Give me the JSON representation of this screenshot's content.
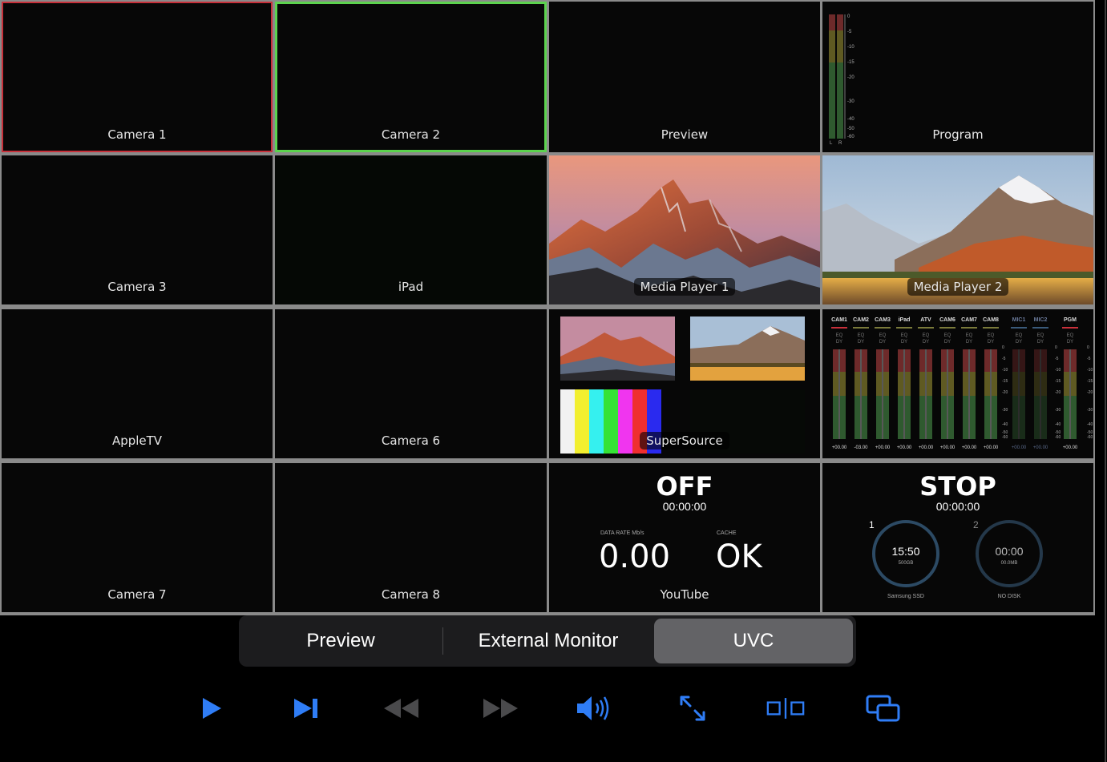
{
  "tiles": [
    {
      "id": "camera-1",
      "label": "Camera 1"
    },
    {
      "id": "camera-2",
      "label": "Camera 2"
    },
    {
      "id": "preview",
      "label": "Preview"
    },
    {
      "id": "program",
      "label": "Program"
    },
    {
      "id": "camera-3",
      "label": "Camera 3"
    },
    {
      "id": "ipad",
      "label": "iPad"
    },
    {
      "id": "media-player-1",
      "label": "Media Player 1"
    },
    {
      "id": "media-player-2",
      "label": "Media Player 2"
    },
    {
      "id": "appletv",
      "label": "AppleTV"
    },
    {
      "id": "camera-6",
      "label": "Camera 6"
    },
    {
      "id": "supersource",
      "label": "SuperSource"
    },
    {
      "id": "audio-mixer",
      "label": ""
    },
    {
      "id": "camera-7",
      "label": "Camera 7"
    },
    {
      "id": "camera-8",
      "label": "Camera 8"
    },
    {
      "id": "youtube",
      "label": "YouTube"
    },
    {
      "id": "recorder",
      "label": ""
    }
  ],
  "program_meter_scale": [
    "0",
    "-5",
    "-10",
    "-15",
    "-20",
    "-30",
    "-40",
    "-50",
    "-60"
  ],
  "program_meter_lr": [
    "L",
    "R"
  ],
  "audio": {
    "channels": [
      "CAM1",
      "CAM2",
      "CAM3",
      "iPad",
      "ATV",
      "CAM6",
      "CAM7",
      "CAM8",
      "MIC1",
      "MIC2",
      "PGM"
    ],
    "values": [
      "+00.00",
      "-03.00",
      "+00.00",
      "+00.00",
      "+00.00",
      "+00.00",
      "+00.00",
      "+00.00",
      "+00.00",
      "+00.00",
      "+00.00"
    ],
    "eq": "EQ",
    "dy": "DY",
    "scale": [
      "0",
      "-5",
      "-10",
      "-15",
      "-20",
      "-30",
      "-40",
      "-50",
      "-60"
    ]
  },
  "stream": {
    "status": "OFF",
    "time": "00:00:00",
    "rate_label": "DATA RATE Mb/s",
    "rate_value": "0.00",
    "cache_label": "CACHE",
    "cache_value": "OK"
  },
  "record": {
    "status": "STOP",
    "time": "00:00:00",
    "disk1": {
      "num": "1",
      "time": "15:50",
      "size": "500GB",
      "name": "Samsung SSD"
    },
    "disk2": {
      "num": "2",
      "time": "00:00",
      "size": "00.0MB",
      "name": "NO DISK"
    }
  },
  "segments": [
    "Preview",
    "External Monitor",
    "UVC"
  ],
  "colors": {
    "accent": "#2f7df6",
    "tally_program": "#c8303a",
    "tally_preview": "#5cd34e"
  },
  "controls": [
    "play-icon",
    "skip-forward-icon",
    "rewind-icon",
    "fast-forward-icon",
    "volume-icon",
    "expand-icon",
    "split-view-icon",
    "picture-in-picture-icon"
  ]
}
